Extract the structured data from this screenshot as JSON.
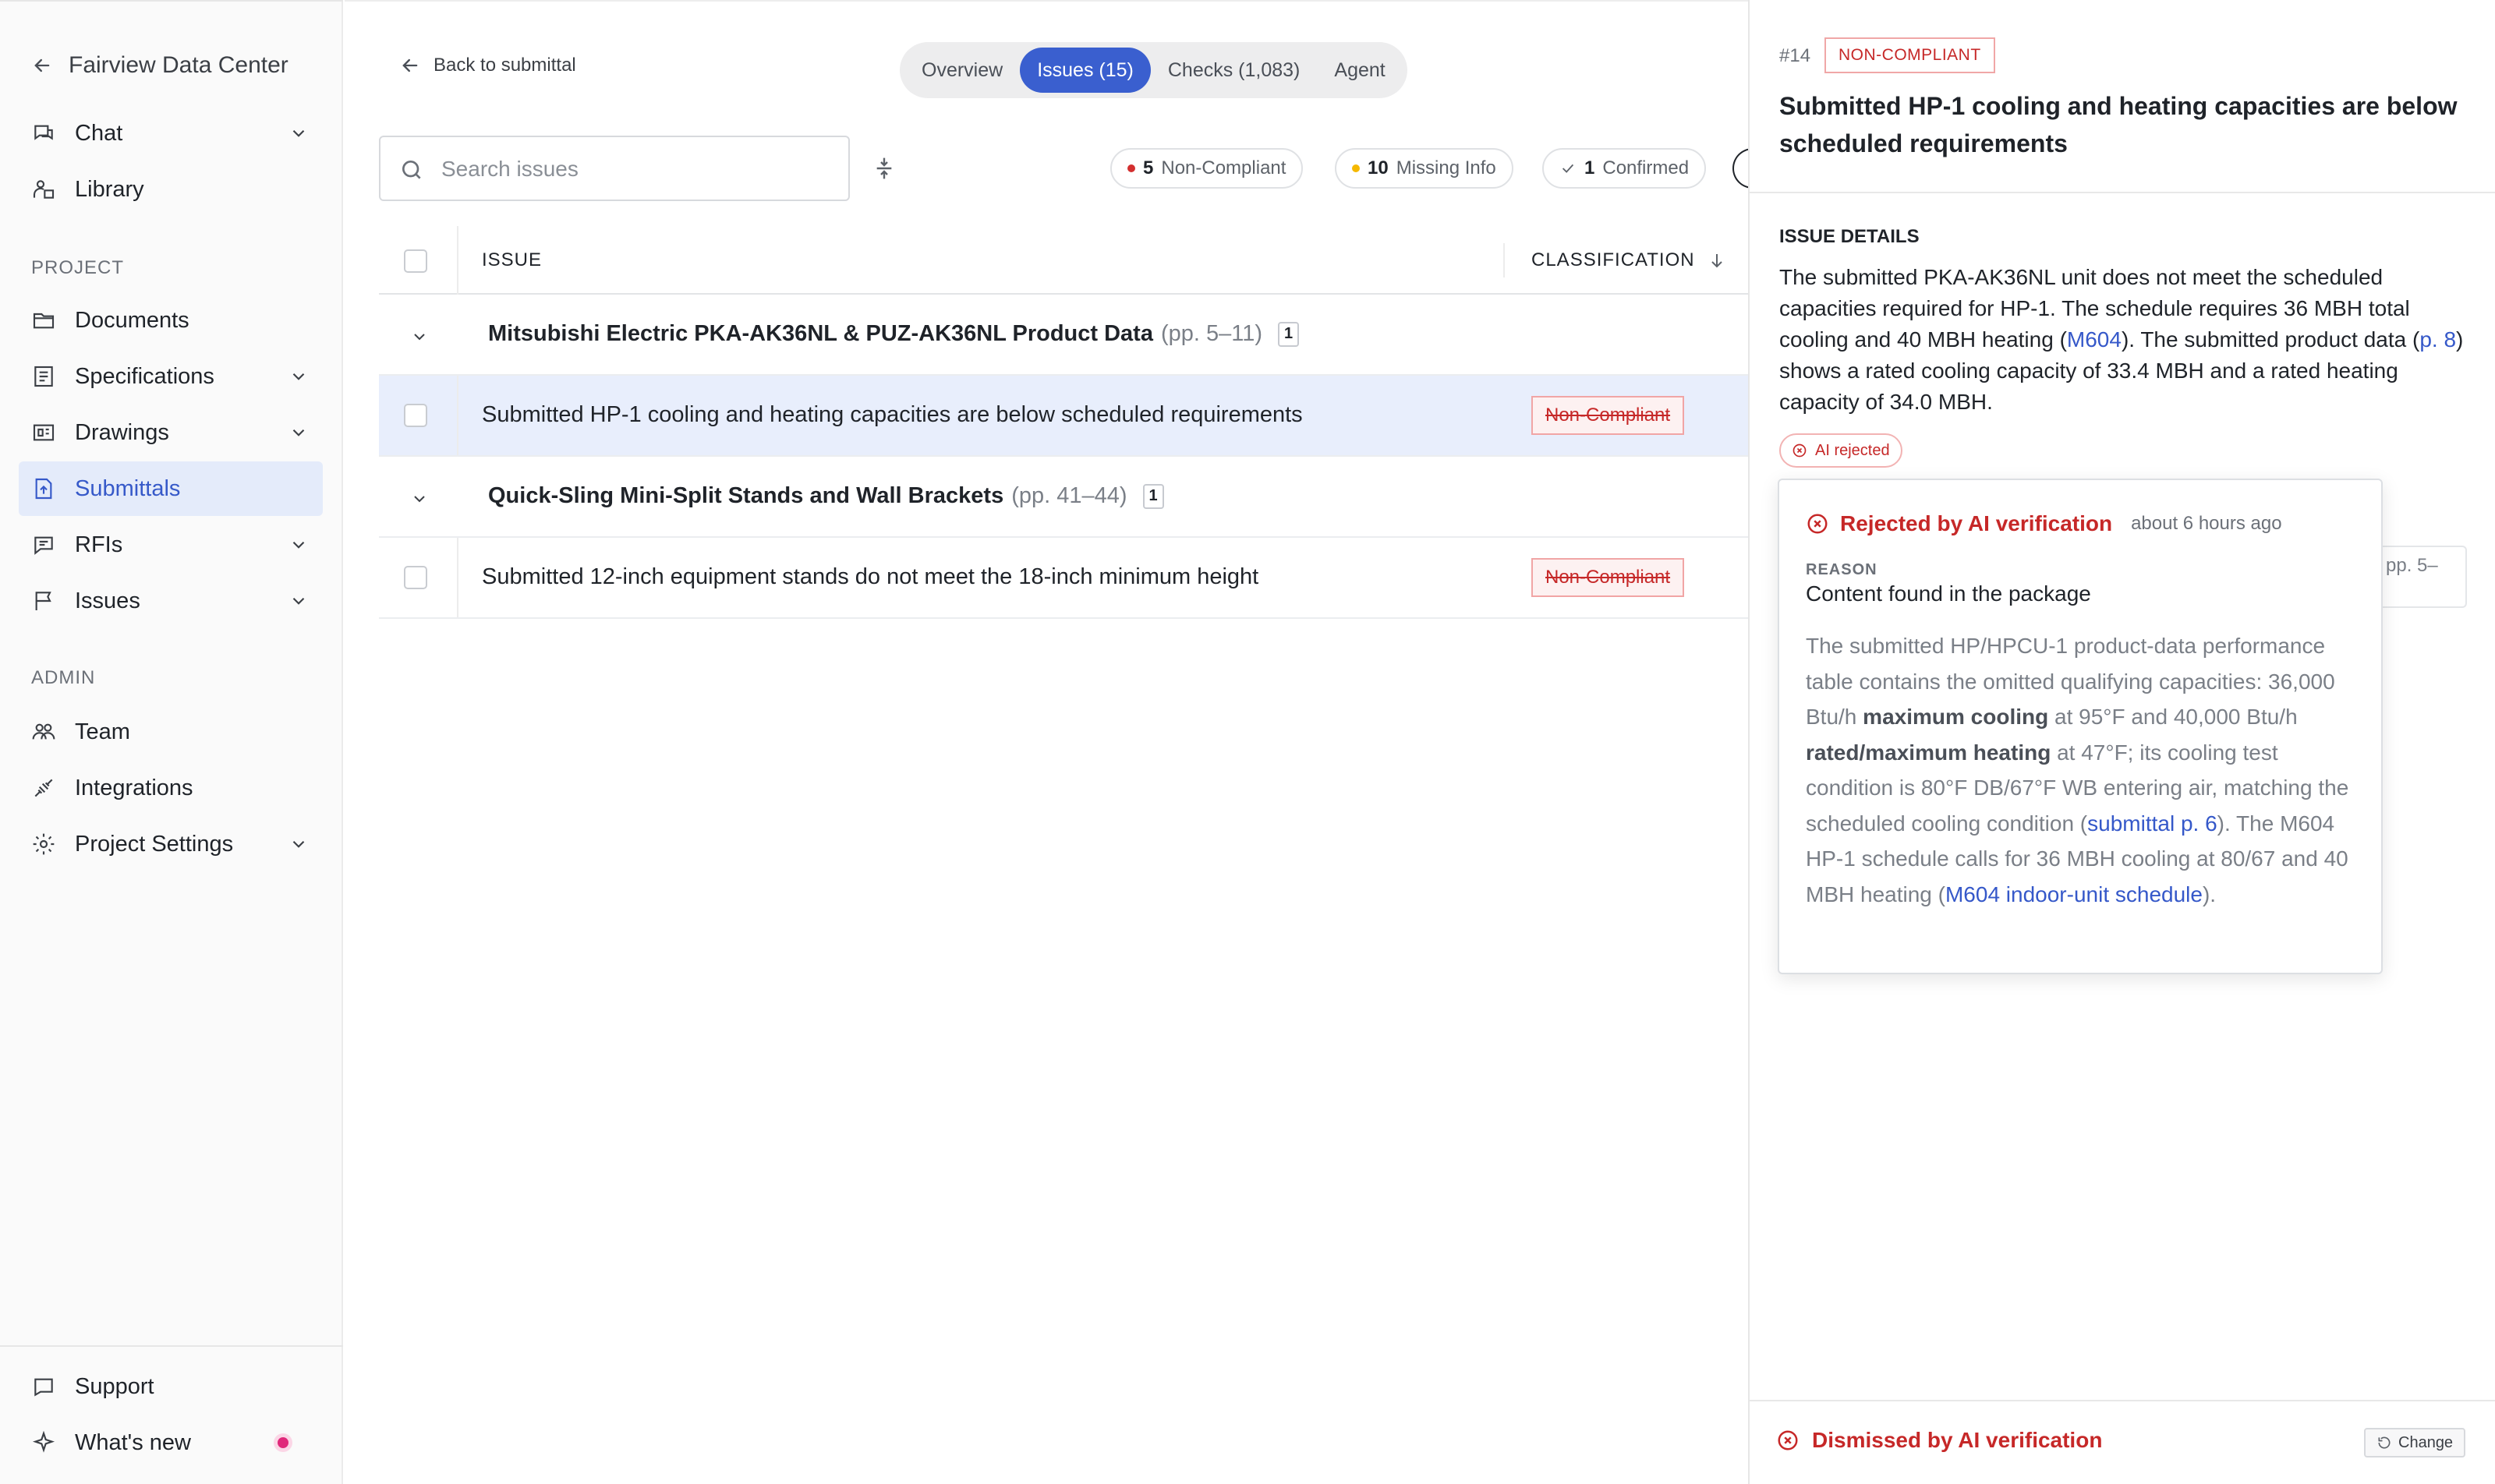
{
  "sidebar": {
    "project_name": "Fairview Data Center",
    "nav": [
      {
        "label": "Chat",
        "icon": "chat-icon",
        "has_chevron": true
      },
      {
        "label": "Library",
        "icon": "library-icon",
        "has_chevron": false
      }
    ],
    "project_section": "PROJECT",
    "project_items": [
      {
        "label": "Documents",
        "icon": "folder-icon",
        "has_chevron": false
      },
      {
        "label": "Specifications",
        "icon": "specifications-icon",
        "has_chevron": true
      },
      {
        "label": "Drawings",
        "icon": "drawings-icon",
        "has_chevron": true
      },
      {
        "label": "Submittals",
        "icon": "submittals-icon",
        "has_chevron": false,
        "active": true
      },
      {
        "label": "RFIs",
        "icon": "rfi-icon",
        "has_chevron": true
      },
      {
        "label": "Issues",
        "icon": "flag-icon",
        "has_chevron": true
      }
    ],
    "admin_section": "ADMIN",
    "admin_items": [
      {
        "label": "Team",
        "icon": "team-icon",
        "has_chevron": false
      },
      {
        "label": "Integrations",
        "icon": "integrations-icon",
        "has_chevron": false
      },
      {
        "label": "Project Settings",
        "icon": "gear-icon",
        "has_chevron": true
      }
    ],
    "bottom_items": [
      {
        "label": "Support",
        "icon": "support-icon"
      },
      {
        "label": "What's new",
        "icon": "sparkle-icon"
      }
    ]
  },
  "main": {
    "back_label": "Back to submittal",
    "tabs": [
      {
        "label": "Overview",
        "active": false
      },
      {
        "label": "Issues (15)",
        "active": true
      },
      {
        "label": "Checks (1,083)",
        "active": false
      },
      {
        "label": "Agent",
        "active": false
      }
    ],
    "search_placeholder": "Search issues",
    "filters": [
      {
        "count": "5",
        "label": "Non-Compliant",
        "color": "#d32f2f"
      },
      {
        "count": "10",
        "label": "Missing Info",
        "color": "#f5b800"
      },
      {
        "count": "1",
        "label": "Confirmed",
        "color": "#1f2329"
      }
    ],
    "columns": {
      "issue": "ISSUE",
      "classification": "CLASSIFICATION"
    },
    "groups": [
      {
        "title": "Mitsubishi Electric PKA-AK36NL & PUZ-AK36NL Product Data",
        "pages": "(pp. 5–11)",
        "count": "1",
        "rows": [
          {
            "text": "Submitted HP-1 cooling and heating capacities are below scheduled requirements",
            "classification": "Non-Compliant",
            "selected": true
          }
        ]
      },
      {
        "title": "Quick-Sling Mini-Split Stands and Wall Brackets",
        "pages": "(pp. 41–44)",
        "count": "1",
        "rows": [
          {
            "text": "Submitted 12-inch equipment stands do not meet the 18-inch minimum height",
            "classification": "Non-Compliant",
            "selected": false
          }
        ]
      }
    ]
  },
  "panel": {
    "issue_number": "#14",
    "tag": "NON-COMPLIANT",
    "title": "Submitted HP-1 cooling and heating capacities are below scheduled requirements",
    "section_label": "ISSUE DETAILS",
    "details": {
      "t1": "The submitted PKA-AK36NL unit does not meet the scheduled capacities required for HP-1. The schedule requires 36 MBH total cooling and 40 MBH heating (",
      "l1": "M604",
      "t2": "). The submitted product data (",
      "l2": "p. 8",
      "t3": ") shows a rated cooling capacity of 33.4 MBH and a rated heating capacity of 34.0 MBH."
    },
    "ai_pill": "AI rejected",
    "popover": {
      "title": "Rejected by AI verification",
      "time": "about 6 hours ago",
      "reason_label": "REASON",
      "reason": "Content found in the package",
      "b1": "The submitted HP/HPCU-1 product-data performance table contains the omitted qualifying capacities: 36,000 Btu/h ",
      "s1": "maximum cooling",
      "b2": " at 95°F and 40,000 Btu/h ",
      "s2": "rated/maximum heating",
      "b3": " at 47°F; its cooling test condition is 80°F DB/67°F WB entering air, matching the scheduled cooling condition (",
      "l1": "submittal p. 6",
      "b4": "). The M604 HP-1 schedule calls for 36 MBH cooling at 80/67 and 40 MBH heating (",
      "l2": "M604 indoor-unit schedule",
      "b5": ")."
    },
    "side_stub": "pp. 5–",
    "footer_status": "Dismissed by AI verification",
    "change_label": "Change"
  },
  "colors": {
    "accent": "#3a5fcf",
    "danger": "#c62828",
    "active_bg": "#e4ebfa"
  }
}
